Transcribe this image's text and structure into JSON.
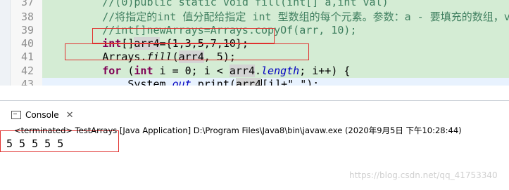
{
  "editor": {
    "lines": [
      {
        "num": "37",
        "parts": [
          {
            "t": "        ",
            "c": ""
          },
          {
            "t": "//(0)public static void fill(int[] a,int val)",
            "c": "cm"
          }
        ]
      },
      {
        "num": "38",
        "parts": [
          {
            "t": "        ",
            "c": ""
          },
          {
            "t": "//将指定的int 值分配给指定 int 型数组的每个元素。参数：a - 要填充的数组，val - 要存",
            "c": "cm"
          }
        ]
      },
      {
        "num": "39",
        "parts": [
          {
            "t": "        ",
            "c": ""
          },
          {
            "t": "//int[]newArrays=Arrays.copyOf(arr, 10);",
            "c": "cm"
          }
        ]
      },
      {
        "num": "40",
        "parts": [
          {
            "t": "        ",
            "c": ""
          },
          {
            "t": "int",
            "c": "kw"
          },
          {
            "t": "[]",
            "c": ""
          },
          {
            "t": "arr4",
            "c": "var-hl"
          },
          {
            "t": "={1,3,5,7,10};",
            "c": ""
          }
        ]
      },
      {
        "num": "41",
        "parts": [
          {
            "t": "        Arrays.",
            "c": ""
          },
          {
            "t": "fill",
            "c": "fld-it"
          },
          {
            "t": "(",
            "c": ""
          },
          {
            "t": "arr4",
            "c": "var-hl"
          },
          {
            "t": ", 5);",
            "c": ""
          }
        ]
      },
      {
        "num": "42",
        "parts": [
          {
            "t": "        ",
            "c": ""
          },
          {
            "t": "for",
            "c": "kw"
          },
          {
            "t": " (",
            "c": ""
          },
          {
            "t": "int",
            "c": "kw"
          },
          {
            "t": " i = 0; i < ",
            "c": ""
          },
          {
            "t": "arr4",
            "c": "var-hl"
          },
          {
            "t": ".",
            "c": ""
          },
          {
            "t": "length",
            "c": "fld"
          },
          {
            "t": "; i++) {",
            "c": ""
          }
        ]
      },
      {
        "num": "43",
        "parts": [
          {
            "t": "            System.",
            "c": ""
          },
          {
            "t": "out",
            "c": "fld"
          },
          {
            "t": ".print(",
            "c": ""
          },
          {
            "t": "arr4",
            "c": "var-hl"
          },
          {
            "t": "CURSOR",
            "c": "cursor"
          },
          {
            "t": "[i]+\" \");",
            "c": ""
          }
        ]
      }
    ]
  },
  "console": {
    "tab_label": "Console",
    "close_symbol": "✕",
    "status": "<terminated> TestArrays [Java Application] D:\\Program Files\\Java8\\bin\\javaw.exe (2020年9月5日 下午10:28:44)",
    "output": "5 5 5 5 5"
  },
  "watermark": "https://blog.csdn.net/qq_41753340"
}
